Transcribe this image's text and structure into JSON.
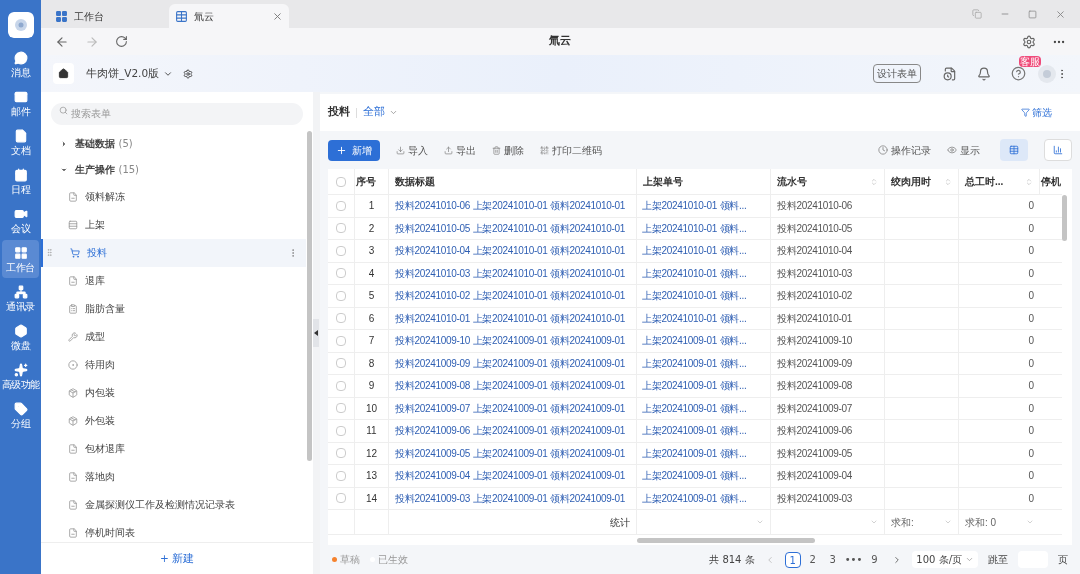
{
  "rail": {
    "items": [
      {
        "label": "消息",
        "selected": false
      },
      {
        "label": "邮件",
        "selected": false
      },
      {
        "label": "文档",
        "selected": false
      },
      {
        "label": "日程",
        "selected": false
      },
      {
        "label": "会议",
        "selected": false
      },
      {
        "label": "工作台",
        "selected": true
      },
      {
        "label": "通讯录",
        "selected": false
      },
      {
        "label": "微盘",
        "selected": false
      },
      {
        "label": "高级功能",
        "selected": false
      },
      {
        "label": "分组",
        "selected": false
      }
    ]
  },
  "tabs": [
    {
      "label": "工作台",
      "selected": false
    },
    {
      "label": "氚云",
      "selected": true
    }
  ],
  "nav": {
    "title": "氚云"
  },
  "app_header": {
    "app_name": "牛肉饼_V2.0版",
    "design_button": "设计表单",
    "support_badge": "客服"
  },
  "sidebar": {
    "search": {
      "placeholder": "搜索表单"
    },
    "groups": [
      {
        "label": "基础数据",
        "count": "(5)",
        "expanded": false
      },
      {
        "label": "生产操作",
        "count": "(15)",
        "expanded": true,
        "children": [
          {
            "label": "领料解冻",
            "selected": false
          },
          {
            "label": "上架",
            "selected": false
          },
          {
            "label": "投料",
            "selected": true
          },
          {
            "label": "退库",
            "selected": false
          },
          {
            "label": "脂肪含量",
            "selected": false
          },
          {
            "label": "成型",
            "selected": false
          },
          {
            "label": "待用肉",
            "selected": false
          },
          {
            "label": "内包装",
            "selected": false
          },
          {
            "label": "外包装",
            "selected": false
          },
          {
            "label": "包材退库",
            "selected": false
          },
          {
            "label": "落地肉",
            "selected": false
          },
          {
            "label": "金属探测仪工作及检测情况记录表",
            "selected": false
          },
          {
            "label": "停机时间表",
            "selected": false
          }
        ]
      }
    ],
    "new_button": "+ 新建"
  },
  "main": {
    "title": "投料",
    "view": "全部",
    "filter": "筛选",
    "toolbar": [
      "导入",
      "导出",
      "删除",
      "打印二维码"
    ],
    "add_button": "新增",
    "history": "操作记录",
    "display": "显示",
    "table": {
      "select_all_checked": false,
      "columns": [
        {
          "label": "序号",
          "sortable": false
        },
        {
          "label": "数据标题",
          "sortable": false
        },
        {
          "label": "上架单号",
          "sortable": false
        },
        {
          "label": "流水号",
          "sortable": true
        },
        {
          "label": "绞肉用时",
          "sortable": true
        },
        {
          "label": "总工时...",
          "sortable": true
        },
        {
          "label": "停机"
        }
      ],
      "rows": [
        {
          "checked": false,
          "cells": [
            "1",
            "投料20241010-06 上架20241010-01 领料20241010-01",
            "上架20241010-01 领料...",
            "投料20241010-06",
            "0"
          ]
        },
        {
          "checked": false,
          "cells": [
            "2",
            "投料20241010-05 上架20241010-01 领料20241010-01",
            "上架20241010-01 领料...",
            "投料20241010-05",
            "0"
          ]
        },
        {
          "checked": false,
          "cells": [
            "3",
            "投料20241010-04 上架20241010-01 领料20241010-01",
            "上架20241010-01 领料...",
            "投料20241010-04",
            "0"
          ]
        },
        {
          "checked": false,
          "cells": [
            "4",
            "投料20241010-03 上架20241010-01 领料20241010-01",
            "上架20241010-01 领料...",
            "投料20241010-03",
            "0"
          ]
        },
        {
          "checked": false,
          "cells": [
            "5",
            "投料20241010-02 上架20241010-01 领料20241010-01",
            "上架20241010-01 领料...",
            "投料20241010-02",
            "0"
          ]
        },
        {
          "checked": false,
          "cells": [
            "6",
            "投料20241010-01 上架20241010-01 领料20241010-01",
            "上架20241010-01 领料...",
            "投料20241010-01",
            "0"
          ]
        },
        {
          "checked": false,
          "cells": [
            "7",
            "投料20241009-10 上架20241009-01 领料20241009-01",
            "上架20241009-01 领料...",
            "投料20241009-10",
            "0"
          ]
        },
        {
          "checked": false,
          "cells": [
            "8",
            "投料20241009-09 上架20241009-01 领料20241009-01",
            "上架20241009-01 领料...",
            "投料20241009-09",
            "0"
          ]
        },
        {
          "checked": false,
          "cells": [
            "9",
            "投料20241009-08 上架20241009-01 领料20241009-01",
            "上架20241009-01 领料...",
            "投料20241009-08",
            "0"
          ]
        },
        {
          "checked": false,
          "cells": [
            "10",
            "投料20241009-07 上架20241009-01 领料20241009-01",
            "上架20241009-01 领料...",
            "投料20241009-07",
            "0"
          ]
        },
        {
          "checked": false,
          "cells": [
            "11",
            "投料20241009-06 上架20241009-01 领料20241009-01",
            "上架20241009-01 领料...",
            "投料20241009-06",
            "0"
          ]
        },
        {
          "checked": false,
          "cells": [
            "12",
            "投料20241009-05 上架20241009-01 领料20241009-01",
            "上架20241009-01 领料...",
            "投料20241009-05",
            "0"
          ]
        },
        {
          "checked": false,
          "cells": [
            "13",
            "投料20241009-04 上架20241009-01 领料20241009-01",
            "上架20241009-01 领料...",
            "投料20241009-04",
            "0"
          ]
        },
        {
          "checked": false,
          "cells": [
            "14",
            "投料20241009-03 上架20241009-01 领料20241009-01",
            "上架20241009-01 领料...",
            "投料20241009-03",
            "0"
          ]
        }
      ],
      "summary": {
        "label": "统计",
        "col_5": "求和:",
        "col_6": "求和: 0"
      }
    },
    "legend": [
      {
        "label": "草稿",
        "color": "#f5822e"
      },
      {
        "label": "已生效",
        "color": "#ffffff"
      }
    ],
    "pagination": {
      "total": "共 814 条",
      "pages": [
        {
          "label": "1",
          "selected": true
        },
        {
          "label": "2",
          "selected": false
        },
        {
          "label": "3",
          "selected": false
        },
        {
          "label": "•••",
          "selected": false
        },
        {
          "label": "9",
          "selected": false
        }
      ],
      "page_size": "100 条/页",
      "jump_label": "跳至",
      "jump_suffix": "页"
    }
  }
}
